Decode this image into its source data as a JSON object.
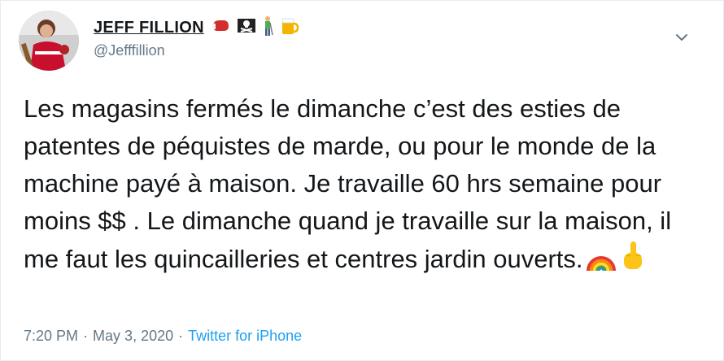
{
  "user": {
    "display_name": "JEFF FILLION",
    "handle": "@Jefffillion",
    "name_emojis": [
      "boxing-glove",
      "pirate-flag",
      "person-golfing",
      "beer-mug"
    ]
  },
  "tweet": {
    "text": "Les magasins fermés le dimanche c’est des esties de patentes de péquistes de marde, ou pour le monde de la machine payé à maison. Je travaille 60 hrs semaine pour moins $$ . Le dimanche quand je travaille sur la maison, il me faut les quincailleries et centres jardin ouverts.",
    "trailing_emojis": [
      "rainbow",
      "middle-finger"
    ]
  },
  "meta": {
    "time": "7:20 PM",
    "separator": "·",
    "date": "May 3, 2020",
    "source": "Twitter for iPhone"
  },
  "colors": {
    "text": "#14171a",
    "secondary": "#657786",
    "link": "#1da1f2",
    "border": "#e6ecf0"
  },
  "icons": {
    "menu": "chevron-down-icon"
  }
}
